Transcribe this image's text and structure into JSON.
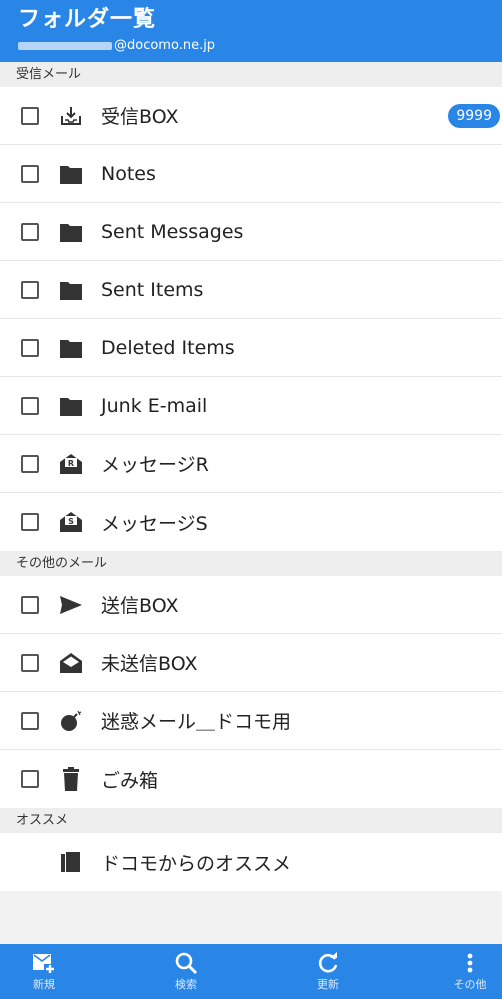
{
  "header": {
    "title": "フォルダ一覧",
    "account": "@docomo.ne.jp"
  },
  "sections": {
    "inbox": {
      "title": "受信メール",
      "items": [
        {
          "label": "受信BOX",
          "icon": "inbox-download-icon",
          "badge": "9999"
        },
        {
          "label": "Notes",
          "icon": "folder-icon"
        },
        {
          "label": "Sent Messages",
          "icon": "folder-icon"
        },
        {
          "label": "Sent Items",
          "icon": "folder-icon"
        },
        {
          "label": "Deleted Items",
          "icon": "folder-icon"
        },
        {
          "label": "Junk E-mail",
          "icon": "folder-icon"
        },
        {
          "label": "メッセージR",
          "icon": "message-r-icon"
        },
        {
          "label": "メッセージS",
          "icon": "message-s-icon"
        }
      ]
    },
    "other": {
      "title": "その他のメール",
      "items": [
        {
          "label": "送信BOX",
          "icon": "send-icon"
        },
        {
          "label": "未送信BOX",
          "icon": "unsent-envelope-icon"
        },
        {
          "label": "迷惑メール＿ドコモ用",
          "icon": "bomb-icon"
        },
        {
          "label": "ごみ箱",
          "icon": "trash-icon"
        }
      ]
    },
    "recommend": {
      "title": "オススメ",
      "items": [
        {
          "label": "ドコモからのオススメ",
          "icon": "recommend-docs-icon"
        }
      ]
    }
  },
  "bottom_nav": [
    {
      "label": "新規",
      "icon": "new-mail-icon"
    },
    {
      "label": "検索",
      "icon": "search-icon"
    },
    {
      "label": "更新",
      "icon": "refresh-icon"
    },
    {
      "label": "その他",
      "icon": "more-vertical-icon"
    }
  ],
  "colors": {
    "primary": "#2a86e6",
    "section_bg": "#eeeeee",
    "icon": "#333333"
  }
}
